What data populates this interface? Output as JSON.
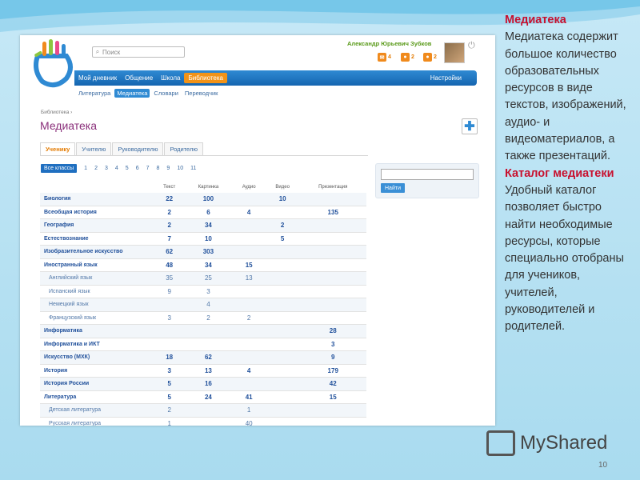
{
  "header": {
    "search_placeholder": "Поиск",
    "user_name": "Александр Юрьевич Зубков",
    "counters": [
      "4",
      "2",
      "2"
    ]
  },
  "nav": {
    "items": [
      "Мой дневник",
      "Общение",
      "Школа",
      "Библиотека"
    ],
    "settings": "Настройки"
  },
  "subnav": [
    "Литература",
    "Медиатека",
    "Словари",
    "Переводчик"
  ],
  "breadcrumb": "Библиотека ›",
  "page_title": "Медиатека",
  "tabs": [
    "Ученику",
    "Учителю",
    "Руководителю",
    "Родителю"
  ],
  "grades": [
    "Все классы",
    "1",
    "2",
    "3",
    "4",
    "5",
    "6",
    "7",
    "8",
    "9",
    "10",
    "11"
  ],
  "table": {
    "columns": [
      "Текст",
      "Картинка",
      "Аудио",
      "Видео",
      "Презентация"
    ],
    "rows": [
      {
        "name": "Биология",
        "sub": false,
        "v": [
          "22",
          "100",
          "",
          "10",
          ""
        ]
      },
      {
        "name": "Всеобщая история",
        "sub": false,
        "v": [
          "2",
          "6",
          "4",
          "",
          "135"
        ]
      },
      {
        "name": "География",
        "sub": false,
        "v": [
          "2",
          "34",
          "",
          "2",
          ""
        ]
      },
      {
        "name": "Естествознание",
        "sub": false,
        "v": [
          "7",
          "10",
          "",
          "5",
          ""
        ]
      },
      {
        "name": "Изобразительное искусство",
        "sub": false,
        "v": [
          "62",
          "303",
          "",
          "",
          ""
        ]
      },
      {
        "name": "Иностранный язык",
        "sub": false,
        "v": [
          "48",
          "34",
          "15",
          "",
          ""
        ]
      },
      {
        "name": "Английский язык",
        "sub": true,
        "v": [
          "35",
          "25",
          "13",
          "",
          ""
        ]
      },
      {
        "name": "Испанский язык",
        "sub": true,
        "v": [
          "9",
          "3",
          "",
          "",
          ""
        ]
      },
      {
        "name": "Немецкий язык",
        "sub": true,
        "v": [
          "",
          "4",
          "",
          "",
          ""
        ]
      },
      {
        "name": "Французский язык",
        "sub": true,
        "v": [
          "3",
          "2",
          "2",
          "",
          ""
        ]
      },
      {
        "name": "Информатика",
        "sub": false,
        "v": [
          "",
          "",
          "",
          "",
          "28"
        ]
      },
      {
        "name": "Информатика и ИКТ",
        "sub": false,
        "v": [
          "",
          "",
          "",
          "",
          "3"
        ]
      },
      {
        "name": "Искусство (МХК)",
        "sub": false,
        "v": [
          "18",
          "62",
          "",
          "",
          "9"
        ]
      },
      {
        "name": "История",
        "sub": false,
        "v": [
          "3",
          "13",
          "4",
          "",
          "179"
        ]
      },
      {
        "name": "История России",
        "sub": false,
        "v": [
          "5",
          "16",
          "",
          "",
          "42"
        ]
      },
      {
        "name": "Литература",
        "sub": false,
        "v": [
          "5",
          "24",
          "41",
          "",
          "15"
        ]
      },
      {
        "name": "Детская литература",
        "sub": true,
        "v": [
          "2",
          "",
          "1",
          "",
          ""
        ]
      },
      {
        "name": "Русская литература",
        "sub": true,
        "v": [
          "1",
          "",
          "40",
          "",
          ""
        ]
      }
    ]
  },
  "search_button": "Найти",
  "side": {
    "h1": "Медиатека",
    "p1": "Медиатека содержит большое количество образовательных ресурсов в виде текстов, изображений, аудио- и видеоматериалов, а также презентаций.",
    "h2": "Каталог медиатеки",
    "p2": "Удобный каталог позволяет быстро найти необходимые ресурсы, которые специально отобраны для учеников, учителей, руководителей и родителей."
  },
  "watermark": "MyShared",
  "page_number": "10"
}
